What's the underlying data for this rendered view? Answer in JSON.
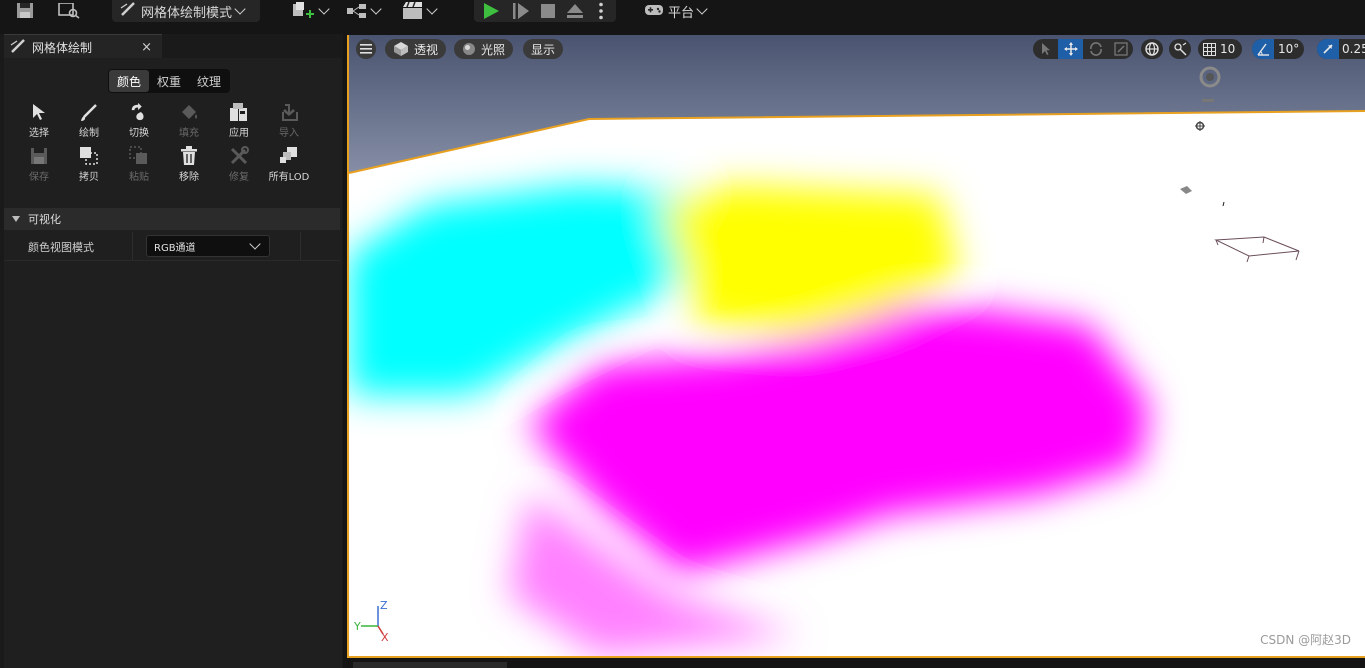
{
  "toolbar": {
    "mode_label": "网格体绘制模式",
    "platform_label": "平台"
  },
  "panel": {
    "tab_title": "网格体绘制",
    "close_glyph": "×",
    "segments": [
      {
        "label": "颜色",
        "active": true
      },
      {
        "label": "权重",
        "active": false
      },
      {
        "label": "纹理",
        "active": false
      }
    ],
    "tools": [
      {
        "label": "选择",
        "icon": "cursor-icon",
        "enabled": true
      },
      {
        "label": "绘制",
        "icon": "brush-icon",
        "enabled": true
      },
      {
        "label": "切换",
        "icon": "swap-icon",
        "enabled": true
      },
      {
        "label": "填充",
        "icon": "fill-icon",
        "enabled": false
      },
      {
        "label": "应用",
        "icon": "apply-icon",
        "enabled": true
      },
      {
        "label": "导入",
        "icon": "import-icon",
        "enabled": false
      },
      {
        "label": "保存",
        "icon": "save-icon",
        "enabled": false
      },
      {
        "label": "拷贝",
        "icon": "copy-icon",
        "enabled": true
      },
      {
        "label": "粘贴",
        "icon": "paste-icon",
        "enabled": false
      },
      {
        "label": "移除",
        "icon": "trash-icon",
        "enabled": true
      },
      {
        "label": "修复",
        "icon": "wrench-icon",
        "enabled": false
      },
      {
        "label": "所有LOD",
        "icon": "lod-icon",
        "enabled": true
      }
    ],
    "section_title": "可视化",
    "property_label": "颜色视图模式",
    "property_value": "RGB通道"
  },
  "viewport": {
    "menu_icon": "hamburger-icon",
    "perspective_label": "透视",
    "lighting_label": "光照",
    "show_label": "显示",
    "grid_snap": "10",
    "rotation_snap": "10°",
    "scale_snap": "0.25",
    "axis_z": "Z",
    "axis_y": "Y",
    "axis_x": "X",
    "colors": {
      "cyan": "#00ffff",
      "yellow": "#ffff00",
      "magenta": "#ff00ff",
      "accent": "#e8a020",
      "sky": "#6b7590"
    }
  },
  "watermark": "CSDN @阿赵3D"
}
